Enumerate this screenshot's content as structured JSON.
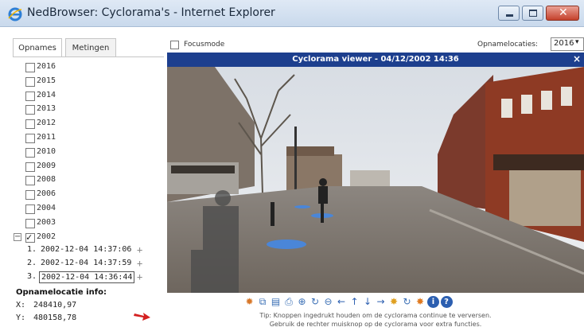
{
  "window": {
    "title": "NedBrowser: Cyclorama's - Internet Explorer"
  },
  "tabs": [
    {
      "label": "Opnames",
      "active": true
    },
    {
      "label": "Metingen",
      "active": false
    }
  ],
  "years": [
    {
      "label": "2016",
      "checked": false
    },
    {
      "label": "2015",
      "checked": false
    },
    {
      "label": "2014",
      "checked": false
    },
    {
      "label": "2013",
      "checked": false
    },
    {
      "label": "2012",
      "checked": false
    },
    {
      "label": "2011",
      "checked": false
    },
    {
      "label": "2010",
      "checked": false
    },
    {
      "label": "2009",
      "checked": false
    },
    {
      "label": "2008",
      "checked": false
    },
    {
      "label": "2006",
      "checked": false
    },
    {
      "label": "2004",
      "checked": false
    },
    {
      "label": "2003",
      "checked": false
    },
    {
      "label": "2002",
      "checked": true
    }
  ],
  "expander_symbol": "−",
  "recordings": [
    {
      "num": "1.",
      "time": "2002-12-04 14:37:06",
      "selected": false
    },
    {
      "num": "2.",
      "time": "2002-12-04 14:37:59",
      "selected": false
    },
    {
      "num": "3.",
      "time": "2002-12-04 14:36:44",
      "selected": true
    }
  ],
  "add_symbol": "+",
  "location_info": {
    "title": "Opnamelocatie info:",
    "x_label": "X:",
    "x_value": "248410,97",
    "y_label": "Y:",
    "y_value": "480158,78"
  },
  "controls": {
    "focusmode_label": "Focusmode",
    "locations_label": "Opnamelocaties:",
    "locations_value": "2016"
  },
  "viewer": {
    "title": "Cyclorama viewer - 04/12/2002 14:36",
    "close_symbol": "×"
  },
  "toolbar_icons": [
    {
      "name": "settings-icon",
      "glyph": "✹",
      "color": "#d8782a"
    },
    {
      "name": "copy-icon",
      "glyph": "⧉",
      "color": "#3a6fb5"
    },
    {
      "name": "save-icon",
      "glyph": "▤",
      "color": "#3a6fb5"
    },
    {
      "name": "print-icon",
      "glyph": "⎙",
      "color": "#3a6fb5"
    },
    {
      "name": "zoom-in-icon",
      "glyph": "⊕",
      "color": "#3a6fb5"
    },
    {
      "name": "refresh-icon",
      "glyph": "↻",
      "color": "#3a6fb5"
    },
    {
      "name": "zoom-out-icon",
      "glyph": "⊖",
      "color": "#3a6fb5"
    },
    {
      "name": "arrow-left-icon",
      "glyph": "←",
      "color": "#2c5fb0"
    },
    {
      "name": "arrow-up-icon",
      "glyph": "↑",
      "color": "#2c5fb0"
    },
    {
      "name": "arrow-down-icon",
      "glyph": "↓",
      "color": "#2c5fb0"
    },
    {
      "name": "arrow-right-icon",
      "glyph": "→",
      "color": "#2c5fb0"
    },
    {
      "name": "brightness-up-icon",
      "glyph": "✸",
      "color": "#e0a020"
    },
    {
      "name": "rotate-icon",
      "glyph": "↻",
      "color": "#3a6fb5"
    },
    {
      "name": "brightness-down-icon",
      "glyph": "✸",
      "color": "#e07a20"
    },
    {
      "name": "info-icon",
      "glyph": "i",
      "color": "#2c5fb0"
    },
    {
      "name": "help-icon",
      "glyph": "?",
      "color": "#2c5fb0"
    }
  ],
  "tips": {
    "line1": "Tip: Knoppen ingedrukt houden om de cyclorama continue te verversen.",
    "line2": "Gebruik de rechter muisknop op de cyclorama voor extra functies."
  },
  "colors": {
    "viewer_header": "#1d3f8e",
    "close_button": "#c5412b",
    "arrow": "#d42020"
  }
}
